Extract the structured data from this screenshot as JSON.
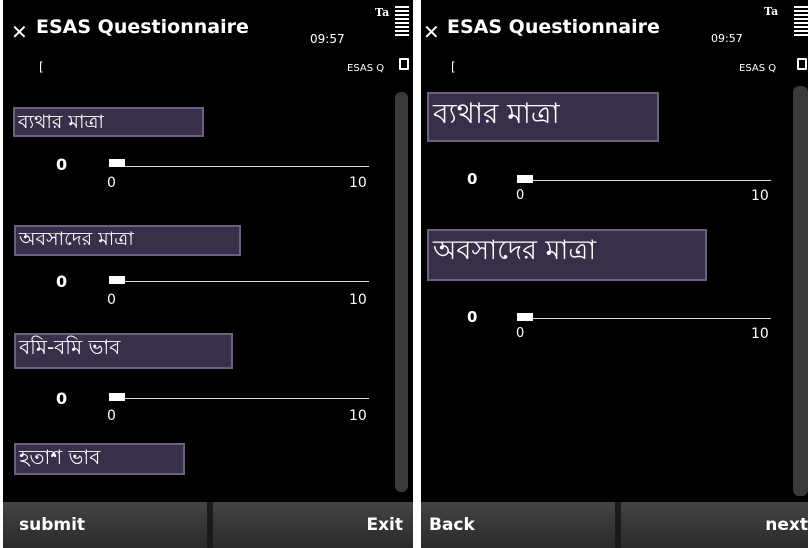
{
  "left": {
    "title": "ESAS Questionnaire",
    "time": "09:57",
    "signal": "Ta",
    "input_cursor": "[",
    "mode": "ESAS Q",
    "questions": [
      {
        "label": "ব্যথার মাত্রা",
        "value": "0",
        "min": "0",
        "max": "10"
      },
      {
        "label": "অবসাদের মাত্রা",
        "value": "0",
        "min": "0",
        "max": "10"
      },
      {
        "label": "বমি-বমি ভাব",
        "value": "0",
        "min": "0",
        "max": "10"
      },
      {
        "label": "হতাশ ভাব"
      }
    ],
    "softkeys": {
      "left": "submit",
      "right": "Exit"
    }
  },
  "right": {
    "title": "ESAS Questionnaire",
    "time": "09:57",
    "signal": "Ta",
    "input_cursor": "[",
    "mode": "ESAS Q",
    "questions": [
      {
        "label": "ব্যথার মাত্রা",
        "value": "0",
        "min": "0",
        "max": "10"
      },
      {
        "label": "অবসাদের মাত্রা",
        "value": "0",
        "min": "0",
        "max": "10"
      }
    ],
    "softkeys": {
      "left": "Back",
      "right": "next"
    }
  }
}
